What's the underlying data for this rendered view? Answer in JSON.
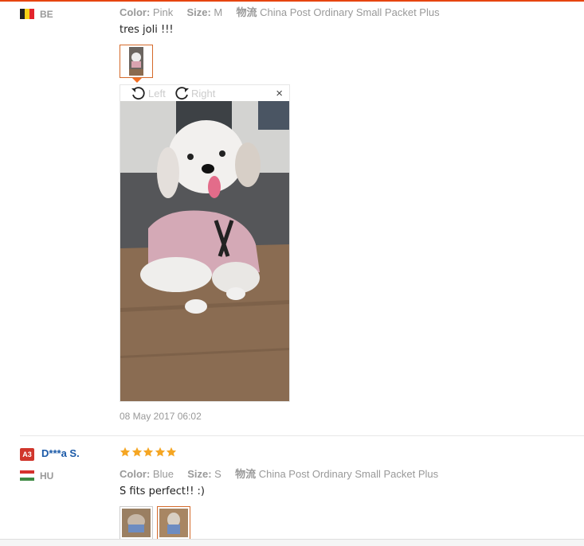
{
  "review1": {
    "country": "BE",
    "color_label": "Color:",
    "color_value": "Pink",
    "size_label": "Size:",
    "size_value": "M",
    "logistics_label": "物流",
    "logistics_value": "China Post Ordinary Small Packet Plus",
    "text": "tres joli !!!",
    "viewer": {
      "rotate_left": "Left",
      "rotate_right": "Right",
      "close": "×"
    },
    "date": "08 May 2017 06:02"
  },
  "review2": {
    "level_badge": "A3",
    "user": "D***a S.",
    "country": "HU",
    "rating": 5,
    "color_label": "Color:",
    "color_value": "Blue",
    "size_label": "Size:",
    "size_value": "S",
    "logistics_label": "物流",
    "logistics_value": "China Post Ordinary Small Packet Plus",
    "text": "S fits perfect!! :)"
  },
  "colors": {
    "accent": "#e64510",
    "thumb_border": "#d56a2a",
    "star": "#f5a623",
    "user_link": "#1b5aa8",
    "badge": "#d0362c"
  }
}
